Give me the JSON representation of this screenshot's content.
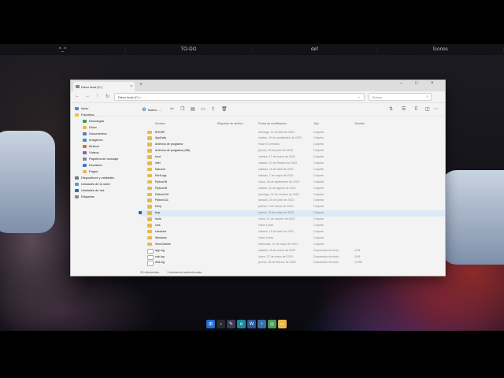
{
  "top_bar": {
    "items": [
      "^_^",
      "TO-DO",
      "def",
      "Íconos"
    ]
  },
  "window": {
    "tab_title": "Disco local (C:)",
    "address": "Disco local (C:)",
    "search_placeholder": "Buscar",
    "toolbar": {
      "new_label": "Nuevo"
    },
    "sidebar": [
      {
        "label": "Inicio",
        "icon": "home-icon"
      },
      {
        "label": "Favoritos",
        "icon": "star-icon"
      },
      {
        "label": "Descargas",
        "icon": "download-icon"
      },
      {
        "label": "Short",
        "icon": "folder-icon"
      },
      {
        "label": "Documentos",
        "icon": "document-icon"
      },
      {
        "label": "Imágenes",
        "icon": "image-icon"
      },
      {
        "label": "Música",
        "icon": "music-icon"
      },
      {
        "label": "Vídeos",
        "icon": "video-icon"
      },
      {
        "label": "Papelera de reciclaje",
        "icon": "recycle-bin-icon"
      },
      {
        "label": "Escritorio",
        "icon": "desktop-icon"
      },
      {
        "label": "Pagos",
        "icon": "folder-icon"
      },
      {
        "label": "Dispositivos y unidades",
        "icon": "drive-icon"
      },
      {
        "label": "Unidades de la nube",
        "icon": "cloud-icon"
      },
      {
        "label": "Unidades de red",
        "icon": "network-icon"
      },
      {
        "label": "Etiquetas",
        "icon": "tag-icon"
      }
    ],
    "columns": {
      "name": "Nombre",
      "tags": "Etiquetas de archivo",
      "date": "Fecha de modificación",
      "type": "Tipo",
      "size": "Tamaño"
    },
    "files": [
      {
        "name": "$TEMP",
        "date": "domingo, 11 de abril de 2021",
        "type": "Carpeta",
        "size": ""
      },
      {
        "name": "AppData",
        "date": "martes, 15 de septiembre de 2020",
        "type": "Carpeta",
        "size": ""
      },
      {
        "name": "Archivos de programa",
        "date": "Hace 47 minutos",
        "type": "Carpeta",
        "size": ""
      },
      {
        "name": "Archivos de programa (x86)",
        "date": "jueves, 29 de junio de 2023",
        "type": "Carpeta",
        "size": ""
      },
      {
        "name": "boot",
        "date": "viernes, 17 de enero de 2020",
        "type": "Carpeta",
        "size": ""
      },
      {
        "name": "intel",
        "date": "sábado, 24 de febrero de 2020",
        "type": "Carpeta",
        "size": ""
      },
      {
        "name": "Macrom",
        "date": "sábado, 15 de abril de 2023",
        "type": "Carpeta",
        "size": ""
      },
      {
        "name": "PerfLogs",
        "date": "sábado, 7 de mayo de 2022",
        "type": "Carpeta",
        "size": ""
      },
      {
        "name": "Python38",
        "date": "lunes, 28 de septiembre de 2020",
        "type": "Carpeta",
        "size": ""
      },
      {
        "name": "Python39",
        "date": "martes, 31 de agosto de 2021",
        "type": "Carpeta",
        "size": ""
      },
      {
        "name": "Python310",
        "date": "domingo, 16 de octubre de 2022",
        "type": "Carpeta",
        "size": ""
      },
      {
        "name": "Python311",
        "date": "sábado, 24 de junio de 2023",
        "type": "Carpeta",
        "size": ""
      },
      {
        "name": "temp",
        "date": "jueves, 2 de marzo de 2023",
        "type": "Carpeta",
        "size": ""
      },
      {
        "name": "tmp",
        "date": "jueves, 18 de mayo de 2023",
        "type": "Carpeta",
        "size": ""
      },
      {
        "name": "tools",
        "date": "lunes, 31 de octubre de 2022",
        "type": "Carpeta",
        "size": ""
      },
      {
        "name": "unis",
        "date": "Hace 6 días",
        "type": "Carpeta",
        "size": ""
      },
      {
        "name": "Usuarios",
        "date": "sábado, 15 de abril de 2023",
        "type": "Carpeta",
        "size": ""
      },
      {
        "name": "Windows",
        "date": "Hace 4 días",
        "type": "Carpeta",
        "size": ""
      },
      {
        "name": "XboxGames",
        "date": "miércoles, 31 de mayo de 2023",
        "type": "Carpeta",
        "size": ""
      },
      {
        "name": "app.log",
        "date": "sábado, 18 de enero de 2020",
        "type": "Documento de texto",
        "size": "10 B"
      },
      {
        "name": "cdb.log",
        "date": "lunes, 27 de enero de 2020",
        "type": "Documento de texto",
        "size": "10 B"
      },
      {
        "name": "d3d.log",
        "date": "jueves, 28 de febrero de 2022",
        "type": "Documento de texto",
        "size": "12 KB"
      }
    ],
    "selected_index": 13,
    "status": {
      "count": "23 elementos",
      "selection": "1 elemento seleccionado"
    }
  },
  "colors": {
    "folder": "#e8b84a",
    "accent": "#0a66c2",
    "selected_row": "#dde9f6"
  }
}
